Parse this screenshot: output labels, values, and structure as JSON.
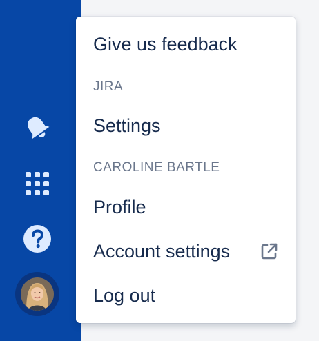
{
  "sidebar": {
    "icons": [
      "notifications-icon",
      "app-switcher-icon",
      "help-icon"
    ],
    "avatar": "profile-avatar",
    "background_color": "#0747a6"
  },
  "menu": {
    "feedback": "Give us feedback",
    "section_app": "JIRA",
    "settings": "Settings",
    "section_user": "CAROLINE BARTLE",
    "profile": "Profile",
    "account_settings": "Account settings",
    "account_settings_icon": "external-link-icon",
    "logout": "Log out"
  },
  "colors": {
    "text_primary": "#172b4d",
    "text_section": "#6b778c",
    "icon_light": "#deebff"
  }
}
